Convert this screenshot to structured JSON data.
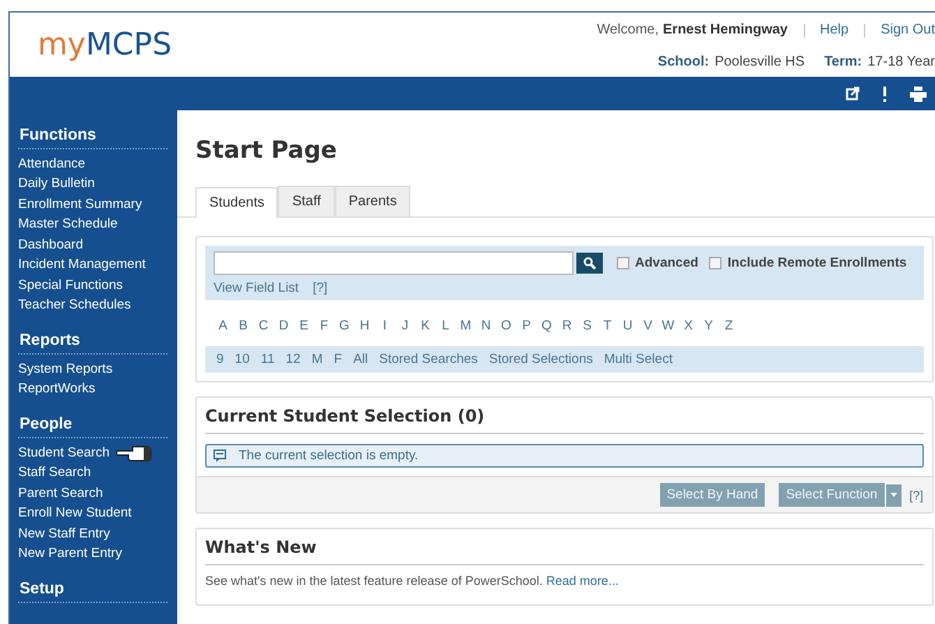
{
  "header": {
    "logo_first": "my",
    "logo_second": "MCPS",
    "welcome_label": "Welcome,",
    "user_name": "Ernest Hemingway",
    "links": [
      "Help",
      "Sign Out"
    ],
    "school_label": "School:",
    "school": "Poolesville HS",
    "term_label": "Term:",
    "term": "17-18 Year"
  },
  "sidebar": {
    "sections": [
      {
        "title": "Functions",
        "items": [
          "Attendance",
          "Daily Bulletin",
          "Enrollment Summary",
          "Master Schedule",
          "Dashboard",
          "Incident Management",
          "Special Functions",
          "Teacher Schedules"
        ]
      },
      {
        "title": "Reports",
        "items": [
          "System Reports",
          "ReportWorks"
        ]
      },
      {
        "title": "People",
        "items": [
          "Student Search",
          "Staff Search",
          "Parent Search",
          "Enroll New Student",
          "New Staff Entry",
          "New Parent Entry"
        ]
      },
      {
        "title": "Setup"
      }
    ]
  },
  "page_title": "Start Page",
  "tabs": [
    {
      "label": "Students",
      "selected": true
    },
    {
      "label": "Staff",
      "selected": false
    },
    {
      "label": "Parents",
      "selected": false
    }
  ],
  "search": {
    "options": [
      {
        "label": "Advanced",
        "checked": false
      },
      {
        "label": "Include Remote Enrollments",
        "checked": false
      }
    ],
    "field_list_link": "View Field List",
    "help": "[?]",
    "letters": [
      "A",
      "B",
      "C",
      "D",
      "E",
      "F",
      "G",
      "H",
      "I",
      "J",
      "K",
      "L",
      "M",
      "N",
      "O",
      "P",
      "Q",
      "R",
      "S",
      "T",
      "U",
      "V",
      "W",
      "X",
      "Y",
      "Z"
    ],
    "filters": [
      "9",
      "10",
      "11",
      "12",
      "M",
      "F",
      "All",
      "Stored Searches",
      "Stored Selections",
      "Multi Select"
    ]
  },
  "selection": {
    "title": "Current Student Selection (0)",
    "message": "The current selection is empty.",
    "buttons": [
      "Select By Hand",
      "Select Function"
    ],
    "help": "[?]"
  },
  "whats_new": {
    "title": "What's New",
    "text": "See what's new in the latest feature release of PowerSchool.",
    "link": "Read more..."
  }
}
